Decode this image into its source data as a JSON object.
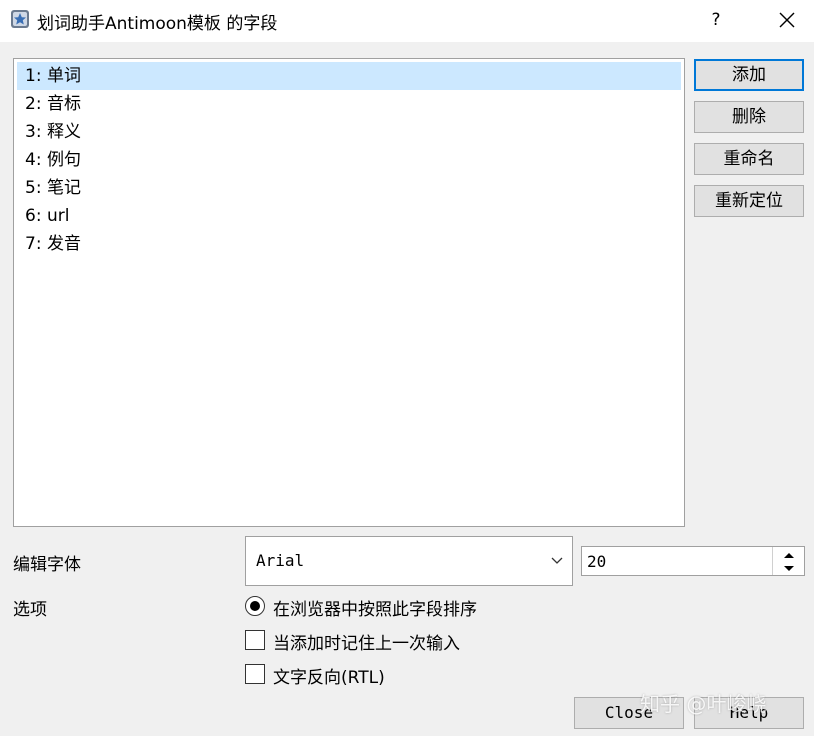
{
  "window": {
    "title": "划词助手Antimoon模板 的字段",
    "help_label": "?",
    "icon": "anki-star-icon"
  },
  "fields": [
    {
      "label": "1: 单词",
      "selected": true
    },
    {
      "label": "2: 音标",
      "selected": false
    },
    {
      "label": "3: 释义",
      "selected": false
    },
    {
      "label": "4: 例句",
      "selected": false
    },
    {
      "label": "5: 笔记",
      "selected": false
    },
    {
      "label": "6: url",
      "selected": false
    },
    {
      "label": "7: 发音",
      "selected": false
    }
  ],
  "side_buttons": {
    "add": "添加",
    "delete": "删除",
    "rename": "重命名",
    "reposition": "重新定位"
  },
  "options": {
    "font_label": "编辑字体",
    "font_value": "Arial",
    "font_size": "20",
    "options_label": "选项",
    "sort_field": "在浏览器中按照此字段排序",
    "remember_last": "当添加时记住上一次输入",
    "rtl": "文字反向(RTL)"
  },
  "bottom_buttons": {
    "close": "Close",
    "help": "Help"
  },
  "watermark": "知乎 @叶峻峣",
  "colors": {
    "selection": "#cce8ff",
    "accent": "#0078d7"
  }
}
